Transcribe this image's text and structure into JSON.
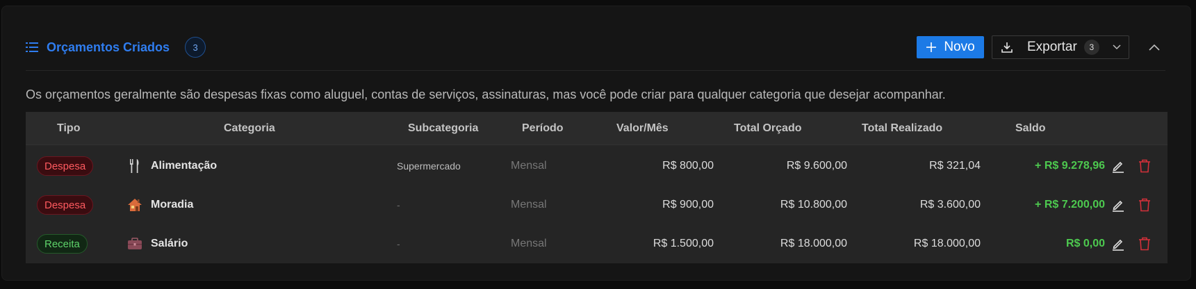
{
  "header": {
    "title": "Orçamentos Criados",
    "count": "3",
    "new_label": "Novo",
    "export_label": "Exportar",
    "export_count": "3"
  },
  "description": "Os orçamentos geralmente são despesas fixas como aluguel, contas de serviços, assinaturas, mas você pode criar para qualquer categoria que desejar acompanhar.",
  "table": {
    "columns": [
      "Tipo",
      "Categoria",
      "Subcategoria",
      "Período",
      "Valor/Mês",
      "Total Orçado",
      "Total Realizado",
      "Saldo"
    ],
    "rows": [
      {
        "tipo": "Despesa",
        "tipo_kind": "despesa",
        "icon": "fork-knife-icon",
        "categoria": "Alimentação",
        "subcategoria": "Supermercado",
        "periodo": "Mensal",
        "valor_mes": "R$ 800,00",
        "total_orcado": "R$ 9.600,00",
        "total_realizado": "R$ 321,04",
        "saldo": "+ R$ 9.278,96"
      },
      {
        "tipo": "Despesa",
        "tipo_kind": "despesa",
        "icon": "house-icon",
        "categoria": "Moradia",
        "subcategoria": "-",
        "periodo": "Mensal",
        "valor_mes": "R$ 900,00",
        "total_orcado": "R$ 10.800,00",
        "total_realizado": "R$ 3.600,00",
        "saldo": "+ R$ 7.200,00"
      },
      {
        "tipo": "Receita",
        "tipo_kind": "receita",
        "icon": "briefcase-icon",
        "categoria": "Salário",
        "subcategoria": "-",
        "periodo": "Mensal",
        "valor_mes": "R$ 1.500,00",
        "total_orcado": "R$ 18.000,00",
        "total_realizado": "R$ 18.000,00",
        "saldo": "R$ 0,00"
      }
    ]
  },
  "colors": {
    "accent": "#1c7ae6",
    "despesa": "#ff5a5f",
    "receita": "#5ed36a",
    "saldo": "#4dc94f",
    "delete": "#d3303a"
  }
}
